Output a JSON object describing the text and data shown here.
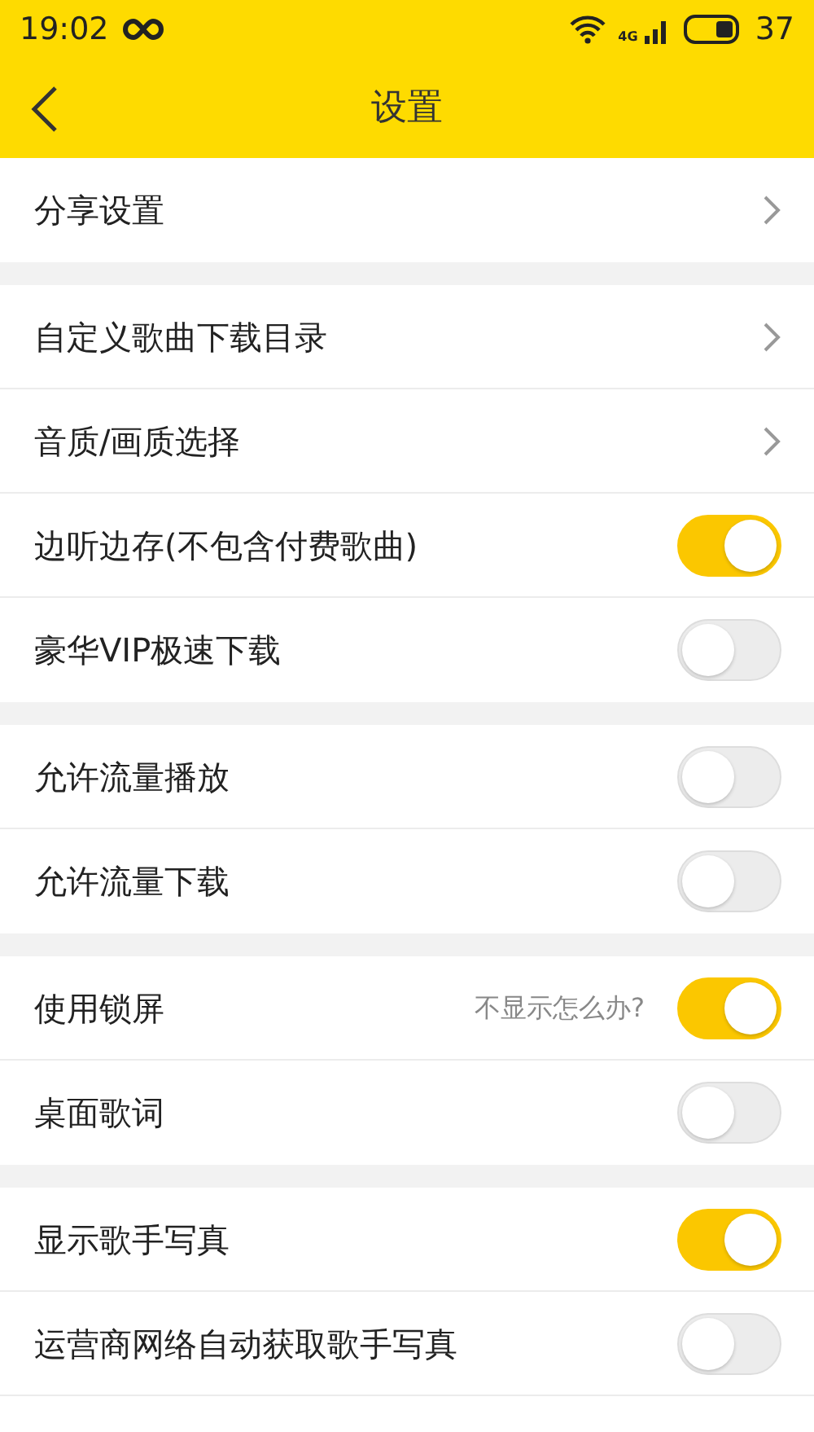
{
  "status_bar": {
    "time": "19:02",
    "network": "4G",
    "battery": "37"
  },
  "header": {
    "title": "设置"
  },
  "sections": [
    {
      "items": [
        {
          "kind": "link",
          "label": "分享设置"
        }
      ]
    },
    {
      "items": [
        {
          "kind": "link",
          "label": "自定义歌曲下载目录"
        },
        {
          "kind": "link",
          "label": "音质/画质选择"
        },
        {
          "kind": "toggle",
          "label": "边听边存(不包含付费歌曲)",
          "on": true
        },
        {
          "kind": "toggle",
          "label": "豪华VIP极速下载",
          "on": false
        }
      ]
    },
    {
      "items": [
        {
          "kind": "toggle",
          "label": "允许流量播放",
          "on": false
        },
        {
          "kind": "toggle",
          "label": "允许流量下载",
          "on": false
        }
      ]
    },
    {
      "items": [
        {
          "kind": "toggle",
          "label": "使用锁屏",
          "hint": "不显示怎么办?",
          "on": true
        },
        {
          "kind": "toggle",
          "label": "桌面歌词",
          "on": false
        }
      ]
    },
    {
      "items": [
        {
          "kind": "toggle",
          "label": "显示歌手写真",
          "on": true
        },
        {
          "kind": "toggle",
          "label": "运营商网络自动获取歌手写真",
          "on": false
        },
        {
          "kind": "blank"
        }
      ]
    }
  ]
}
